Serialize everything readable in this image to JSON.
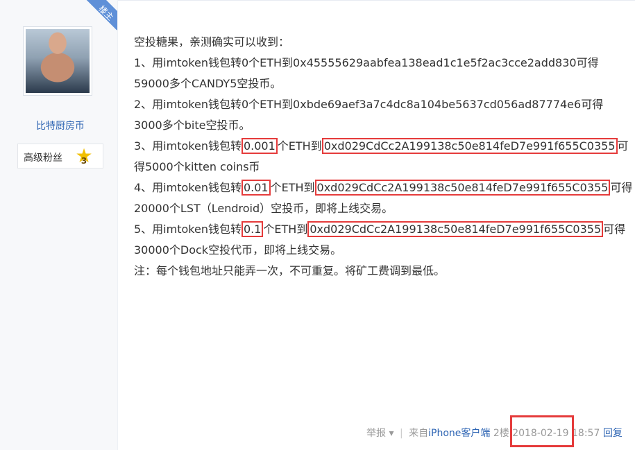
{
  "floor_tag": "楼主",
  "user": {
    "name": "比特厨房币",
    "level_label": "高级粉丝",
    "level_num": "3",
    "level_icon": "star-badge-icon"
  },
  "post": {
    "intro": "空投糖果，亲测确实可以收到：",
    "item1_a": "1、用imtoken钱包转0个ETH到0x45555629aabfea138ead1c1e5f2ac3cce2add830可得",
    "item1_b": "59000多个CANDY5空投币。",
    "item2_a": "2、用imtoken钱包转0个ETH到0xbde69aef3a7c4dc8a104be5637cd056ad87774e6可得",
    "item2_b": "3000多个bite空投币。",
    "item3_pre": "3、用imtoken钱包转",
    "item3_amount": "0.001",
    "item3_mid": "个ETH到",
    "item3_addr": "0xd029CdCc2A199138c50e814feD7e991f655C0355",
    "item3_post": "可",
    "item3_b": "得5000个kitten coins币",
    "item4_pre": "4、用imtoken钱包转",
    "item4_amount": "0.01",
    "item4_mid": "个ETH到",
    "item4_addr": "0xd029CdCc2A199138c50e814feD7e991f655C0355",
    "item4_post": "可得",
    "item4_b": "20000个LST（Lendroid）空投币，即将上线交易。",
    "item5_pre": "5、用imtoken钱包转",
    "item5_amount": "0.1",
    "item5_mid": "个ETH到",
    "item5_addr": "0xd029CdCc2A199138c50e814feD7e991f655C0355",
    "item5_post": "可得",
    "item5_b": "30000个Dock空投代币，即将上线交易。",
    "note": "注：每个钱包地址只能弄一次，不可重复。将矿工费调到最低。"
  },
  "footer": {
    "report": "举报",
    "source_prefix": "来自",
    "source_client": "iPhone客户端",
    "floor": "2楼",
    "timestamp": "2018-02-19 18:57",
    "reply": "回复"
  },
  "colors": {
    "highlight": "#e53b3b",
    "link": "#2d64b3",
    "tag": "#5f90d8"
  }
}
